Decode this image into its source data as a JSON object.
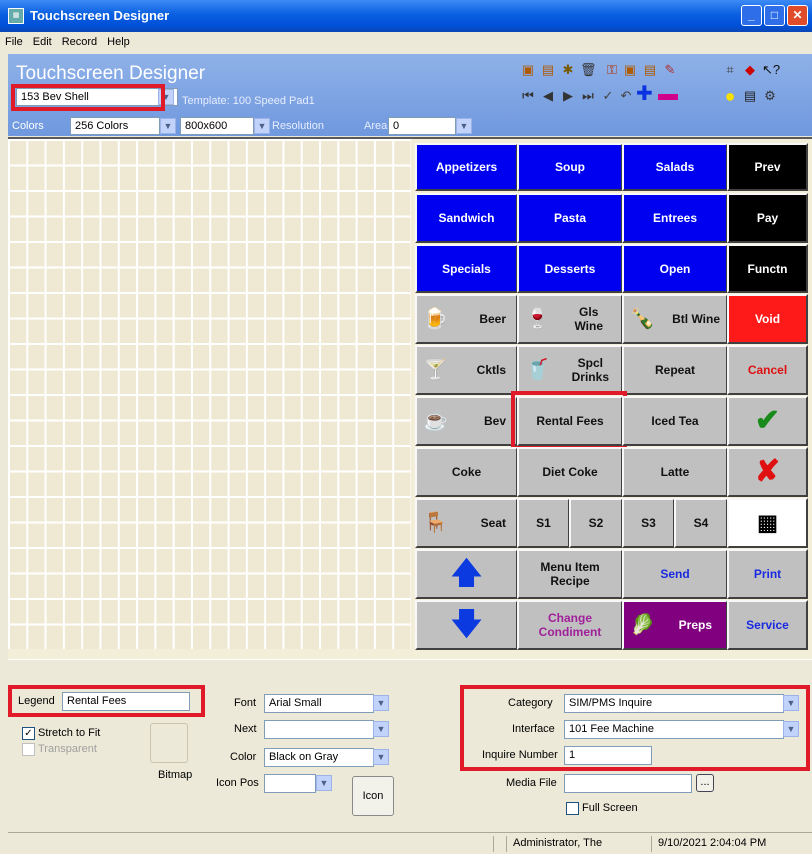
{
  "window": {
    "title": "Touchscreen Designer"
  },
  "menu": [
    "File",
    "Edit",
    "Record",
    "Help"
  ],
  "header": {
    "heading": "Touchscreen Designer",
    "shell_value": "153  Bev Shell",
    "template_text": "Template: 100 Speed Pad1",
    "colors_label": "Colors",
    "colors_value": "256 Colors",
    "resolution_value": "800x600",
    "resolution_label": "Resolution",
    "area_label": "Area",
    "area_value": "0"
  },
  "buttons": {
    "appetizers": "Appetizers",
    "soup": "Soup",
    "salads": "Salads",
    "prev": "Prev",
    "sandwich": "Sandwich",
    "pasta": "Pasta",
    "entrees": "Entrees",
    "pay": "Pay",
    "specials": "Specials",
    "desserts": "Desserts",
    "open": "Open",
    "functn": "Functn",
    "beer": "Beer",
    "gls_wine": "Gls\nWine",
    "btl_wine": "Btl Wine",
    "void": "Void",
    "ckltls": "Cktls",
    "spcl_drinks": "Spcl\nDrinks",
    "repeat": "Repeat",
    "cancel": "Cancel",
    "bev": "Bev",
    "rental_fees": "Rental Fees",
    "iced_tea": "Iced Tea",
    "coke": "Coke",
    "diet_coke": "Diet Coke",
    "latte": "Latte",
    "seat": "Seat",
    "s1": "S1",
    "s2": "S2",
    "s3": "S3",
    "s4": "S4",
    "menu_item_recipe": "Menu Item\nRecipe",
    "send": "Send",
    "print": "Print",
    "change_condiment": "Change\nCondiment",
    "preps": "Preps",
    "service": "Service"
  },
  "form": {
    "legend_label": "Legend",
    "legend_value": "Rental Fees",
    "stretch_label": "Stretch to Fit",
    "transparent_label": "Transparent",
    "bitmap_label": "Bitmap",
    "font_label": "Font",
    "font_value": "Arial Small",
    "next_label": "Next",
    "next_value": "",
    "color_label": "Color",
    "color_value": "Black on Gray",
    "iconpos_label": "Icon Pos",
    "iconpos_value": "",
    "icon_button": "Icon",
    "category_label": "Category",
    "category_value": "SIM/PMS Inquire",
    "interface_label": "Interface",
    "interface_value": "101  Fee Machine",
    "inquire_label": "Inquire Number",
    "inquire_value": "1",
    "media_label": "Media File",
    "media_value": "",
    "fullscreen_label": "Full Screen",
    "browse_label": "..."
  },
  "status": {
    "user": "Administrator, The",
    "datetime": "9/10/2021 2:04:04 PM"
  },
  "colors": {
    "accent_red": "#e11a2a",
    "titlebar": "#0a5fe0",
    "button_blue": "#0000f0"
  }
}
